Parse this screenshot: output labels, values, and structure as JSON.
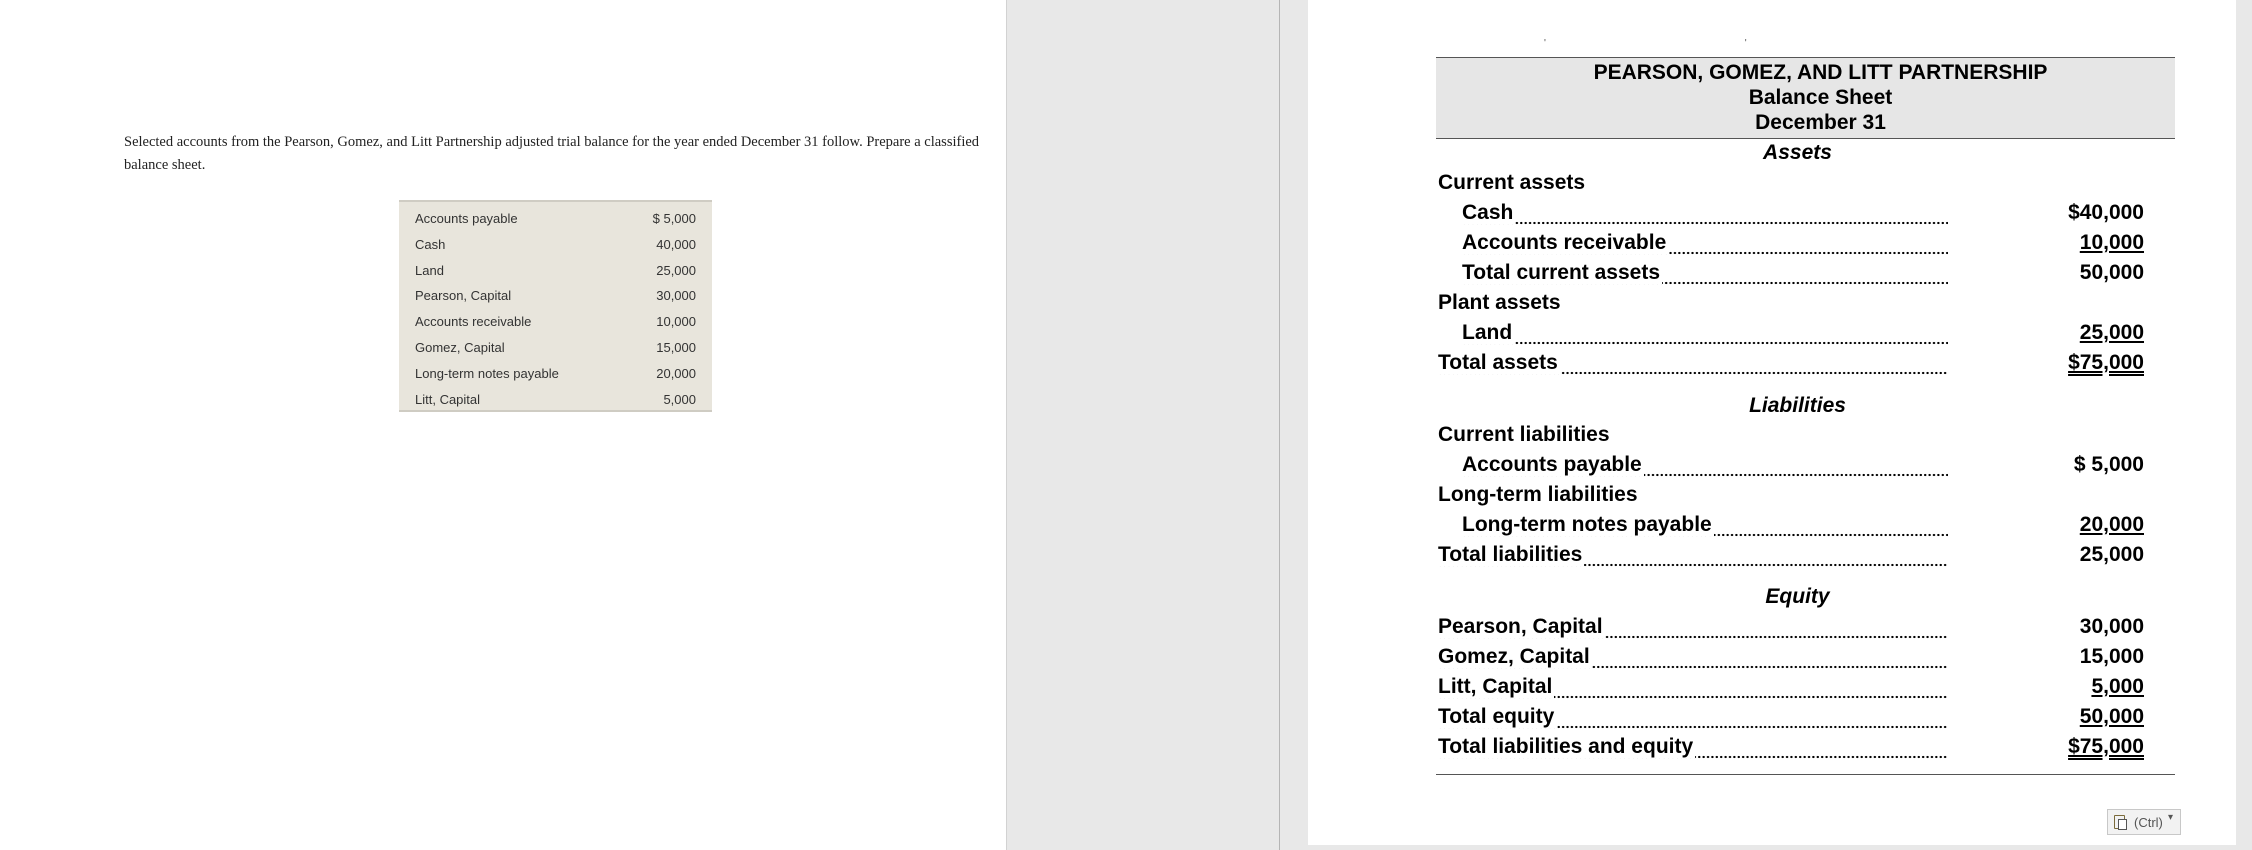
{
  "problem": {
    "intro": "Selected accounts from the Pearson, Gomez, and Litt Partnership adjusted trial balance for the year ended December 31 follow. Prepare a classified balance sheet.",
    "accounts": [
      {
        "name": "Accounts payable",
        "amount": "$ 5,000"
      },
      {
        "name": "Cash",
        "amount": "40,000"
      },
      {
        "name": "Land",
        "amount": "25,000"
      },
      {
        "name": "Pearson, Capital",
        "amount": "30,000"
      },
      {
        "name": "Accounts receivable",
        "amount": "10,000"
      },
      {
        "name": "Gomez, Capital",
        "amount": "15,000"
      },
      {
        "name": "Long-term notes payable",
        "amount": "20,000"
      },
      {
        "name": "Litt, Capital",
        "amount": "5,000"
      }
    ]
  },
  "sheet": {
    "top_ticks": "' '",
    "company": "PEARSON, GOMEZ, AND LITT PARTNERSHIP",
    "statement": "Balance Sheet",
    "date": "December 31",
    "assets": {
      "heading": "Assets",
      "current_label": "Current assets",
      "cash": {
        "label": "Cash",
        "amount": "$40,000"
      },
      "ar": {
        "label": "Accounts receivable",
        "amount": "10,000"
      },
      "tca": {
        "label": "Total current assets",
        "amount": "50,000"
      },
      "plant_label": "Plant assets",
      "land": {
        "label": "Land",
        "amount": "25,000"
      },
      "total": {
        "label": "Total assets",
        "amount": "$75,000"
      }
    },
    "liabilities": {
      "heading": "Liabilities",
      "current_label": "Current liabilities",
      "ap": {
        "label": "Accounts payable",
        "amount": "$ 5,000"
      },
      "lt_label": "Long-term liabilities",
      "ltnp": {
        "label": "Long-term notes payable",
        "amount": "20,000"
      },
      "total": {
        "label": "Total liabilities",
        "amount": "25,000"
      }
    },
    "equity": {
      "heading": "Equity",
      "pearson": {
        "label": "Pearson, Capital",
        "amount": "30,000"
      },
      "gomez": {
        "label": "Gomez, Capital",
        "amount": "15,000"
      },
      "litt": {
        "label": "Litt, Capital",
        "amount": "5,000"
      },
      "total": {
        "label": "Total equity",
        "amount": "50,000"
      },
      "total_le": {
        "label": "Total liabilities and equity",
        "amount": "$75,000"
      }
    }
  },
  "paste_options": {
    "label": "(Ctrl)",
    "icon": "clipboard-icon"
  }
}
